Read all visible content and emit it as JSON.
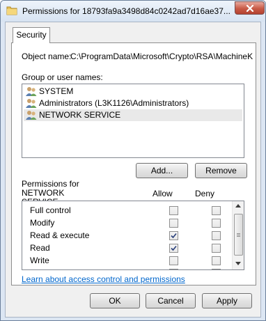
{
  "window": {
    "title": "Permissions for 18793fa9a3498d84c0242ad7d16ae37..."
  },
  "tabs": [
    {
      "label": "Security"
    }
  ],
  "object": {
    "label": "Object name:",
    "value": "C:\\ProgramData\\Microsoft\\Crypto\\RSA\\MachineK"
  },
  "groups": {
    "label": "Group or user names:",
    "items": [
      {
        "label": "SYSTEM"
      },
      {
        "label": "Administrators (L3K1126\\Administrators)"
      },
      {
        "label": "NETWORK SERVICE",
        "selected": true
      }
    ]
  },
  "buttons": {
    "add": "Add...",
    "remove": "Remove",
    "ok": "OK",
    "cancel": "Cancel",
    "apply": "Apply"
  },
  "permissions": {
    "label_line1": "Permissions for NETWORK",
    "label_line2": "SERVICE",
    "allow_header": "Allow",
    "deny_header": "Deny",
    "rows": [
      {
        "name": "Full control",
        "allow": false,
        "deny": false
      },
      {
        "name": "Modify",
        "allow": false,
        "deny": false
      },
      {
        "name": "Read & execute",
        "allow": true,
        "deny": false
      },
      {
        "name": "Read",
        "allow": true,
        "deny": false
      },
      {
        "name": "Write",
        "allow": false,
        "deny": false
      }
    ]
  },
  "help_link": "Learn about access control and permissions",
  "colors": {
    "link": "#0066cc",
    "close_button": "#c85a46",
    "titlebar": "#d7e3f2"
  }
}
